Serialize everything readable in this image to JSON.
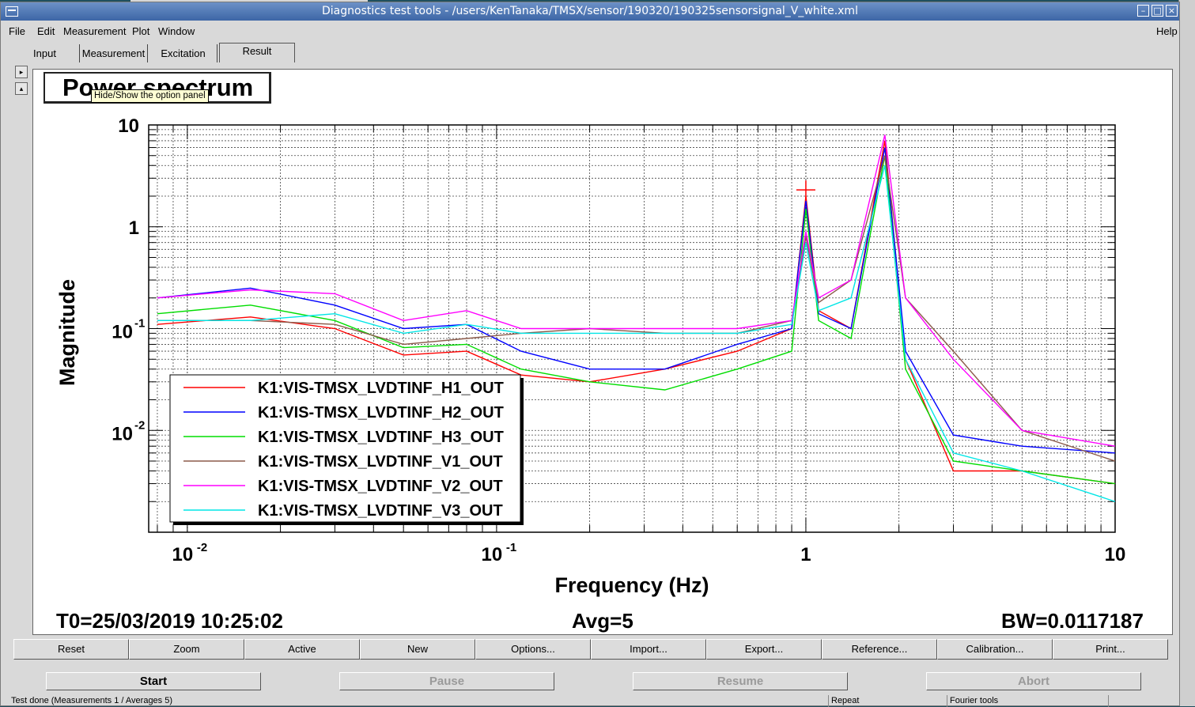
{
  "window": {
    "title": "Diagnostics test tools - /users/KenTanaka/TMSX/sensor/190320/190325sensorsignal_V_white.xml"
  },
  "menu": {
    "file": "File",
    "edit": "Edit",
    "measurement": "Measurement",
    "plot": "Plot",
    "window": "Window",
    "help": "Help"
  },
  "tabs": [
    "Input",
    "Measurement",
    "Excitation",
    "Result"
  ],
  "plot": {
    "title": "Power spectrum",
    "tooltip": "Hide/Show the option panel"
  },
  "info": {
    "t0": "T0=25/03/2019 10:25:02",
    "avg": "Avg=5",
    "bw": "BW=0.0117187"
  },
  "buttons": [
    "Reset",
    "Zoom",
    "Active",
    "New",
    "Options...",
    "Import...",
    "Export...",
    "Reference...",
    "Calibration...",
    "Print..."
  ],
  "controls": {
    "start": "Start",
    "pause": "Pause",
    "resume": "Resume",
    "abort": "Abort"
  },
  "status": {
    "message": "Test done (Measurements 1 / Averages 5)",
    "repeat": "Repeat",
    "tools": "Fourier tools"
  },
  "colors": {
    "H1": "#ff0000",
    "H2": "#0000ff",
    "H3": "#00dd00",
    "V1": "#8b5a4a",
    "V2": "#ff00ff",
    "V3": "#00e6e6"
  },
  "chart_data": {
    "type": "line",
    "title": "Power spectrum",
    "xlabel": "Frequency (Hz)",
    "ylabel": "Magnitude",
    "x_scale": "log",
    "y_scale": "log",
    "xlim": [
      0.0075,
      10
    ],
    "ylim": [
      0.001,
      10
    ],
    "x_ticks": [
      "10",
      "-2",
      "10",
      "-1",
      "1",
      "10"
    ],
    "y_ticks": [
      "10",
      "1",
      "10",
      "-1",
      "10",
      "-2"
    ],
    "grid": true,
    "legend_position": "bottom-left",
    "x": [
      0.008,
      0.016,
      0.03,
      0.05,
      0.08,
      0.12,
      0.2,
      0.35,
      0.6,
      0.9,
      1.0,
      1.1,
      1.4,
      1.8,
      2.1,
      3.0,
      5.0,
      10.0
    ],
    "series": [
      {
        "name": "K1:VIS-TMSX_LVDTINF_H1_OUT",
        "values": [
          0.11,
          0.13,
          0.1,
          0.055,
          0.06,
          0.035,
          0.03,
          0.04,
          0.06,
          0.1,
          2.0,
          0.15,
          0.1,
          7.0,
          0.05,
          0.004,
          0.004,
          0.003
        ]
      },
      {
        "name": "K1:VIS-TMSX_LVDTINF_H2_OUT",
        "values": [
          0.2,
          0.25,
          0.17,
          0.1,
          0.11,
          0.06,
          0.04,
          0.04,
          0.07,
          0.1,
          1.8,
          0.14,
          0.1,
          6.0,
          0.06,
          0.009,
          0.007,
          0.006
        ]
      },
      {
        "name": "K1:VIS-TMSX_LVDTINF_H3_OUT",
        "values": [
          0.14,
          0.17,
          0.12,
          0.065,
          0.07,
          0.04,
          0.03,
          0.025,
          0.04,
          0.06,
          1.5,
          0.12,
          0.08,
          5.0,
          0.04,
          0.005,
          0.004,
          0.003
        ]
      },
      {
        "name": "K1:VIS-TMSX_LVDTINF_V1_OUT",
        "values": [
          0.12,
          0.12,
          0.11,
          0.07,
          0.08,
          0.09,
          0.1,
          0.09,
          0.09,
          0.12,
          0.8,
          0.18,
          0.3,
          5.0,
          0.2,
          0.06,
          0.01,
          0.005
        ]
      },
      {
        "name": "K1:VIS-TMSX_LVDTINF_V2_OUT",
        "values": [
          0.2,
          0.24,
          0.22,
          0.12,
          0.15,
          0.1,
          0.1,
          0.1,
          0.1,
          0.12,
          0.9,
          0.2,
          0.3,
          8.0,
          0.2,
          0.05,
          0.01,
          0.007
        ]
      },
      {
        "name": "K1:VIS-TMSX_LVDTINF_V3_OUT",
        "values": [
          0.12,
          0.12,
          0.14,
          0.09,
          0.11,
          0.09,
          0.09,
          0.09,
          0.09,
          0.11,
          0.7,
          0.15,
          0.2,
          4.0,
          0.05,
          0.006,
          0.004,
          0.002
        ]
      }
    ]
  }
}
